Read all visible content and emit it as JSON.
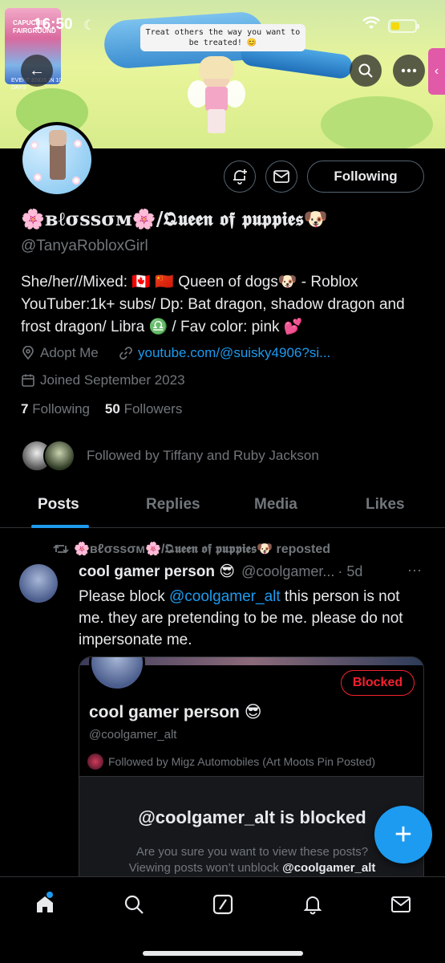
{
  "status_bar": {
    "time": "16:50"
  },
  "banner": {
    "speech": "Treat others the way you want to be treated! 😊",
    "sign_text": "CAPUCHIN FAIRGROUND",
    "sign_sub": "EVENT ENDS IN 10 DAYS"
  },
  "header_buttons": {
    "back": "←",
    "search": "search",
    "more": "more",
    "side_tab": "‹"
  },
  "profile": {
    "display_name": "🌸ʙℓσѕѕσм🌸/𝕼𝖚𝖊𝖊𝖓 𝖔𝖋 𝖕𝖚𝖕𝖕𝖎𝖊𝖘🐶",
    "handle": "@TanyaRobloxGirl",
    "follow_label": "Following",
    "bio": "She/her//Mixed: 🇨🇦 🇨🇳 Queen of dogs🐶 - Roblox YouTuber:1k+ subs/ Dp: Bat dragon, shadow dragon and frost dragon/ Libra ♎️ / Fav color: pink 💕",
    "location": "Adopt Me",
    "website": "youtube.com/@suisky4906?si...",
    "joined": "Joined September 2023",
    "following_count": "7",
    "following_label": "Following",
    "followers_count": "50",
    "followers_label": "Followers",
    "followed_by": "Followed by Tiffany and Ruby Jackson"
  },
  "tabs": [
    {
      "label": "Posts",
      "active": true
    },
    {
      "label": "Replies",
      "active": false
    },
    {
      "label": "Media",
      "active": false
    },
    {
      "label": "Likes",
      "active": false
    }
  ],
  "post": {
    "repost_by": "🌸ʙℓσѕѕσм🌸/𝕼𝖚𝖊𝖊𝖓 𝖔𝖋 𝖕𝖚𝖕𝖕𝖎𝖊𝖘🐶 reposted",
    "author_name": "cool gamer person 😎",
    "author_handle": "@coolgamer...",
    "age": "· 5d",
    "more": "···",
    "text_before": "Please block ",
    "mention": "@coolgamer_alt",
    "text_after": " this person is not me. they are pretending to be me. please do not impersonate me.",
    "card": {
      "name": "cool gamer person 😎",
      "handle": "@coolgamer_alt",
      "followed_by": "Followed by Migz Automobiles (Art Moots Pin Posted)",
      "blocked_label": "Blocked",
      "blocked_title": "@coolgamer_alt is blocked",
      "blocked_sub_line1": "Are you sure you want to view these posts?",
      "blocked_sub_prefix": "Viewing posts won’t unblock ",
      "blocked_sub_handle": "@coolgamer_alt"
    }
  },
  "fab": "+",
  "colors": {
    "accent": "#1d9bf0",
    "blocked": "#f4212e",
    "muted": "#71767b"
  }
}
